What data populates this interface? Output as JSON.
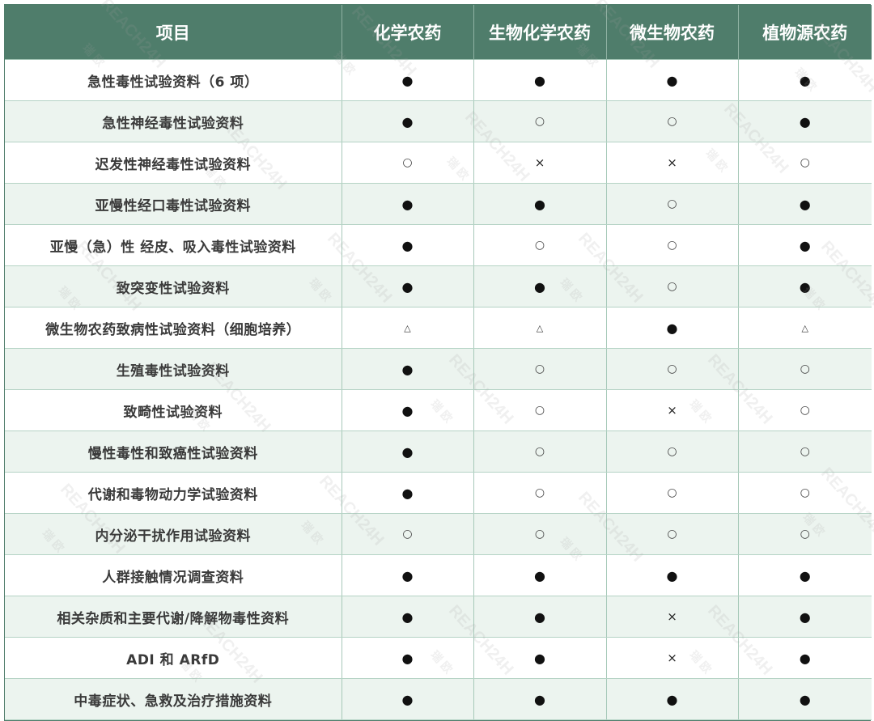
{
  "table": {
    "headers": [
      "项目",
      "化学农药",
      "生物化学农药",
      "微生物农药",
      "植物源农药"
    ],
    "rows": [
      {
        "item": "急性毒性试验资料（6 项）",
        "marks": [
          "●",
          "●",
          "●",
          "●"
        ]
      },
      {
        "item": "急性神经毒性试验资料",
        "marks": [
          "●",
          "○",
          "○",
          "●"
        ]
      },
      {
        "item": "迟发性神经毒性试验资料",
        "marks": [
          "○",
          "×",
          "×",
          "○"
        ]
      },
      {
        "item": "亚慢性经口毒性试验资料",
        "marks": [
          "●",
          "●",
          "○",
          "●"
        ]
      },
      {
        "item": "亚慢（急）性 经皮、吸入毒性试验资料",
        "marks": [
          "●",
          "○",
          "○",
          "●"
        ]
      },
      {
        "item": "致突变性试验资料",
        "marks": [
          "●",
          "●",
          "○",
          "●"
        ]
      },
      {
        "item": "微生物农药致病性试验资料（细胞培养）",
        "marks": [
          "△",
          "△",
          "●",
          "△"
        ]
      },
      {
        "item": "生殖毒性试验资料",
        "marks": [
          "●",
          "○",
          "○",
          "○"
        ]
      },
      {
        "item": "致畸性试验资料",
        "marks": [
          "●",
          "○",
          "×",
          "○"
        ]
      },
      {
        "item": "慢性毒性和致癌性试验资料",
        "marks": [
          "●",
          "○",
          "○",
          "○"
        ]
      },
      {
        "item": "代谢和毒物动力学试验资料",
        "marks": [
          "●",
          "○",
          "○",
          "○"
        ]
      },
      {
        "item": "内分泌干扰作用试验资料",
        "marks": [
          "○",
          "○",
          "○",
          "○"
        ]
      },
      {
        "item": "人群接触情况调查资料",
        "marks": [
          "●",
          "●",
          "●",
          "●"
        ]
      },
      {
        "item": "相关杂质和主要代谢/降解物毒性资料",
        "marks": [
          "●",
          "●",
          "×",
          "●"
        ]
      },
      {
        "item": "ADI 和 ARfD",
        "marks": [
          "●",
          "●",
          "×",
          "●"
        ]
      },
      {
        "item": "中毒症状、急救及治疗措施资料",
        "marks": [
          "●",
          "●",
          "●",
          "●"
        ]
      }
    ]
  },
  "watermark": {
    "text": "REACH24H",
    "subtext": "瑞 欧"
  },
  "colors": {
    "header_bg": "#4f7d6b",
    "header_text": "#ffffff",
    "row_alt_bg": "#ecf4ef",
    "grid_line": "#a7c9b9"
  }
}
